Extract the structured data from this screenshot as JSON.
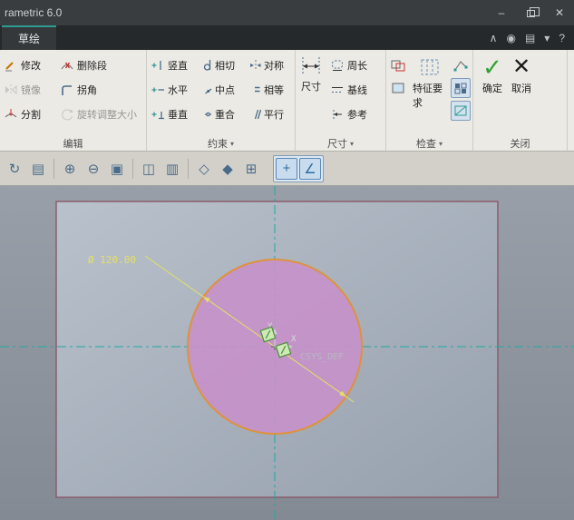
{
  "colors": {
    "ok-green": "#2fa12f",
    "accent-teal": "#1fa9a2",
    "plane-border": "#8a5868",
    "circle-fill": "#c791ca",
    "circle-stroke": "#df923b",
    "dim-yellow": "#e4e163",
    "handle-fill": "#cde9b5",
    "handle-stroke": "#4f8f3f",
    "csys-gray": "#b4bac0"
  },
  "window": {
    "title": "rametric 6.0",
    "controls": {
      "minimize": "–",
      "close": "✕"
    }
  },
  "tabbar": {
    "active_tab": "草绘",
    "icons": [
      {
        "name": "collapse-ribbon-icon",
        "glyph": "∧"
      },
      {
        "name": "presence-icon",
        "glyph": "◉"
      },
      {
        "name": "command-locator-icon",
        "glyph": "▤"
      },
      {
        "name": "dropdown-icon",
        "glyph": "▾"
      },
      {
        "name": "help-icon",
        "glyph": "?"
      }
    ]
  },
  "ribbon": {
    "dropdown_arrow": "▾",
    "edit": {
      "label": "编辑",
      "items": [
        {
          "label": "修改",
          "disabled": false
        },
        {
          "label": "删除段",
          "disabled": false
        },
        {
          "label": "镜像",
          "disabled": true
        },
        {
          "label": "拐角",
          "disabled": false
        },
        {
          "label": "分割",
          "disabled": false
        },
        {
          "label": "旋转调整大小",
          "disabled": true
        }
      ]
    },
    "constrain": {
      "label": "约束",
      "items": [
        "竖直",
        "相切",
        "对称",
        "水平",
        "中点",
        "相等",
        "垂直",
        "重合",
        "平行"
      ]
    },
    "dimension": {
      "label": "尺寸",
      "main": "尺寸",
      "items": [
        "周长",
        "基线",
        "参考"
      ]
    },
    "inspect": {
      "label": "检查",
      "main": "特征要求"
    },
    "close": {
      "label": "关闭",
      "ok": "确定",
      "ok_glyph": "✓",
      "cancel": "取消",
      "cancel_glyph": "✕"
    }
  },
  "toolbar": {
    "icons": [
      {
        "name": "repaint-icon",
        "glyph": "↻"
      },
      {
        "name": "display-filter-icon",
        "glyph": "▤"
      },
      {
        "name": "zoom-in-icon",
        "glyph": "⊕"
      },
      {
        "name": "zoom-out-icon",
        "glyph": "⊖"
      },
      {
        "name": "refit-icon",
        "glyph": "▣"
      },
      {
        "name": "saved-orientations-icon",
        "glyph": "◫"
      },
      {
        "name": "view-manager-icon",
        "glyph": "▥"
      },
      {
        "name": "display-style-icon",
        "glyph": "◇"
      },
      {
        "name": "shaded-view-icon",
        "glyph": "◆"
      },
      {
        "name": "grid-icon",
        "glyph": "⊞"
      },
      {
        "name": "datum-display-filter-icon",
        "glyph": "+"
      },
      {
        "name": "sketcher-display-filter-icon",
        "glyph": "∠"
      }
    ]
  },
  "canvas": {
    "dimension_label": "Ø 120.00",
    "csys_label": "CSYS_DEF",
    "axis_y": "Y",
    "axis_x": "X"
  }
}
